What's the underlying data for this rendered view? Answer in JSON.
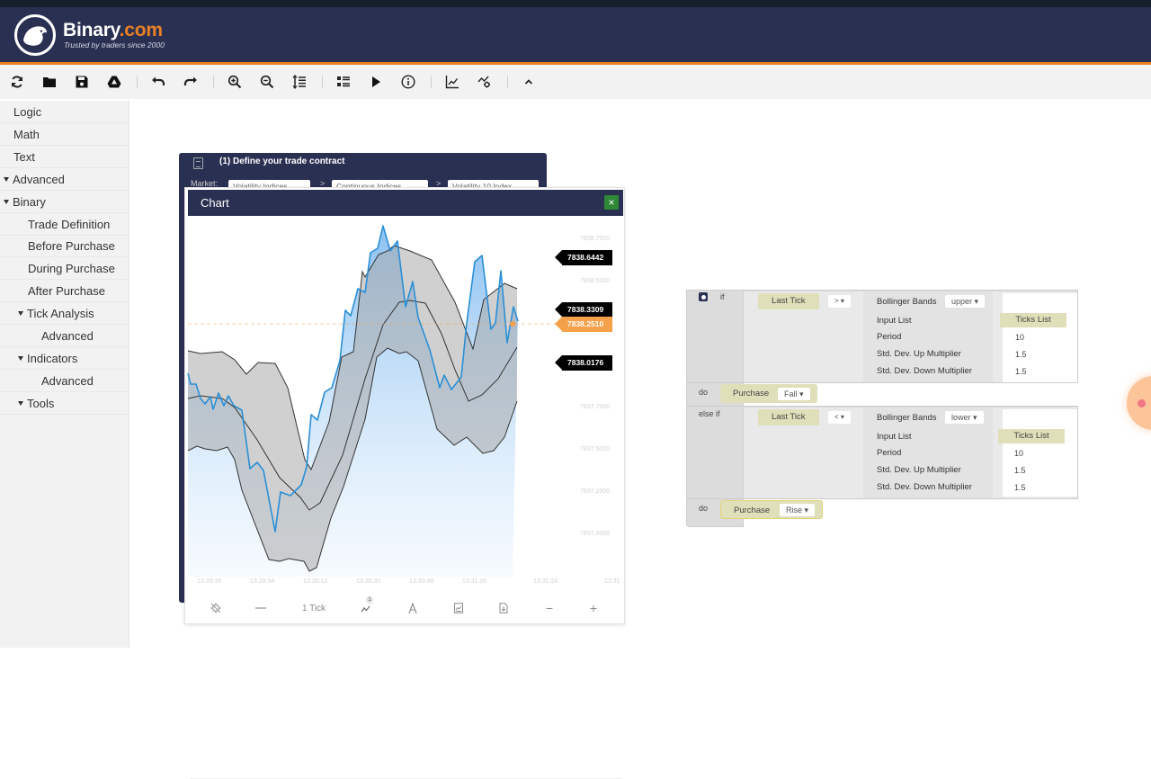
{
  "brand": {
    "name": "Binary",
    "name_suffix": ".com",
    "tagline": "Trusted by traders since 2000"
  },
  "colors": {
    "header_bg": "#2a3052",
    "accent_orange": "#e98024",
    "close_green": "#2e8836",
    "block_yellow": "#dfdfba",
    "tick_line": "#2a8fd6"
  },
  "toolbar": {
    "buttons": [
      {
        "name": "reset-icon"
      },
      {
        "name": "open-folder-icon"
      },
      {
        "name": "save-icon"
      },
      {
        "name": "google-drive-icon"
      },
      {
        "name": "undo-icon"
      },
      {
        "name": "redo-icon"
      },
      {
        "name": "zoom-in-icon"
      },
      {
        "name": "zoom-out-icon"
      },
      {
        "name": "rearrange-icon"
      },
      {
        "name": "show-summary-icon"
      },
      {
        "name": "run-icon"
      },
      {
        "name": "info-icon"
      },
      {
        "name": "chart-icon"
      },
      {
        "name": "trading-view-icon"
      },
      {
        "name": "collapse-icon"
      }
    ]
  },
  "sidebar": {
    "items": [
      {
        "label": "Logic",
        "level": 0,
        "expandable": false
      },
      {
        "label": "Math",
        "level": 0,
        "expandable": false
      },
      {
        "label": "Text",
        "level": 0,
        "expandable": false
      },
      {
        "label": "Advanced",
        "level": 0,
        "expandable": true
      },
      {
        "label": "Binary",
        "level": 0,
        "expandable": true
      },
      {
        "label": "Trade Definition",
        "level": 1,
        "expandable": false
      },
      {
        "label": "Before Purchase",
        "level": 1,
        "expandable": false
      },
      {
        "label": "During Purchase",
        "level": 1,
        "expandable": false
      },
      {
        "label": "After Purchase",
        "level": 1,
        "expandable": false
      },
      {
        "label": "Tick Analysis",
        "level": 1,
        "expandable": true
      },
      {
        "label": "Advanced",
        "level": 2,
        "expandable": false
      },
      {
        "label": "Indicators",
        "level": 1,
        "expandable": true
      },
      {
        "label": "Advanced",
        "level": 2,
        "expandable": false
      },
      {
        "label": "Tools",
        "level": 1,
        "expandable": true
      }
    ]
  },
  "trade_block": {
    "title": "(1) Define your trade contract",
    "market_label": "Market:",
    "market": "Volatility Indices",
    "submarket": "Continuous Indices",
    "symbol": "Volatility 10 Index"
  },
  "chart": {
    "title": "Chart",
    "close_label": "×",
    "y_ticks": [
      "7838.7500",
      "7838.5000",
      "7837.7500",
      "7837.5000",
      "7837.2500",
      "7837.0000"
    ],
    "x_ticks": [
      "13:29:36",
      "13:29:54",
      "13:30:12",
      "13:30:30",
      "13:30:48",
      "13:31:06",
      "13:31:24",
      "13:31"
    ],
    "price_tags": [
      {
        "value": "7838.6442",
        "kind": "upper-band"
      },
      {
        "value": "7838.3309",
        "kind": "middle-band"
      },
      {
        "value": "7838.2510",
        "kind": "current-spot"
      },
      {
        "value": "7838.0176",
        "kind": "lower-band"
      }
    ],
    "bottom_toolbar": {
      "crosshair": "crosshair-icon",
      "chart_type": "line-chart-type-icon",
      "interval_label": "1 Tick",
      "indicators_badge": "1",
      "indicators": "indicators-icon",
      "drawing_tools": "drawing-tools-icon",
      "templates": "chart-templates-icon",
      "download": "download-icon",
      "zoom_out": "−",
      "zoom_in": "+"
    }
  },
  "blocks": {
    "if_label": "if",
    "else_if_label": "else if",
    "do_label": "do",
    "conditions": [
      {
        "left": "Last Tick",
        "operator": "> ▾",
        "indicator": "Bollinger Bands",
        "band": "upper ▾",
        "input_list_label": "Input List",
        "input_list": "Ticks List",
        "period_label": "Period",
        "period": "10",
        "up_mult_label": "Std. Dev. Up Multiplier",
        "up_mult": "1.5",
        "down_mult_label": "Std. Dev. Down Multiplier",
        "down_mult": "1.5",
        "action_label": "Purchase",
        "action": "Fall ▾"
      },
      {
        "left": "Last Tick",
        "operator": "< ▾",
        "indicator": "Bollinger Bands",
        "band": "lower ▾",
        "input_list_label": "Input List",
        "input_list": "Ticks List",
        "period_label": "Period",
        "period": "10",
        "up_mult_label": "Std. Dev. Up Multiplier",
        "up_mult": "1.5",
        "down_mult_label": "Std. Dev. Down Multiplier",
        "down_mult": "1.5",
        "action_label": "Purchase",
        "action": "Rise ▾"
      }
    ]
  }
}
